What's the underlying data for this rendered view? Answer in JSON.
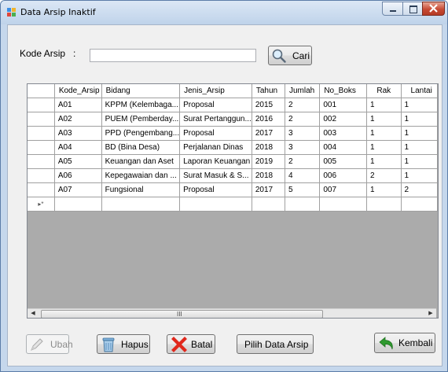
{
  "window": {
    "title": "Data Arsip Inaktif"
  },
  "search": {
    "label": "Kode Arsip   :",
    "value": "",
    "button_label": "Cari"
  },
  "grid": {
    "columns": [
      "Kode_Arsip",
      "Bidang",
      "Jenis_Arsip",
      "Tahun",
      "Jumlah",
      "No_Boks",
      "Rak",
      "Lantai"
    ],
    "rows": [
      [
        "A01",
        "KPPM (Kelembaga...",
        "Proposal",
        "2015",
        "2",
        "001",
        "1",
        "1"
      ],
      [
        "A02",
        "PUEM (Pemberday...",
        "Surat Pertanggun...",
        "2016",
        "2",
        "002",
        "1",
        "1"
      ],
      [
        "A03",
        "PPD (Pengembang...",
        "Proposal",
        "2017",
        "3",
        "003",
        "1",
        "1"
      ],
      [
        "A04",
        "BD (Bina Desa)",
        "Perjalanan Dinas",
        "2018",
        "3",
        "004",
        "1",
        "1"
      ],
      [
        "A05",
        "Keuangan dan Aset",
        "Laporan Keuangan",
        "2019",
        "2",
        "005",
        "1",
        "1"
      ],
      [
        "A06",
        "Kepegawaian dan ...",
        "Surat Masuk & S...",
        "2018",
        "4",
        "006",
        "2",
        "1"
      ],
      [
        "A07",
        "Fungsional",
        "Proposal",
        "2017",
        "5",
        "007",
        "1",
        "2"
      ]
    ],
    "new_row_marker": "▸*",
    "scroll_grip": "III"
  },
  "buttons": {
    "ubah": "Ubah",
    "hapus": "Hapus",
    "batal": "Batal",
    "pilih": "Pilih Data Arsip",
    "kembali": "Kembali"
  },
  "icons": {
    "app": "grid-app-icon",
    "search": "magnifier-icon",
    "ubah": "pencil-icon",
    "hapus": "trash-icon",
    "batal": "red-x-icon",
    "kembali": "green-back-arrow-icon"
  },
  "colors": {
    "title_bar": "#c5d7ec",
    "client_bg": "#f0f0f0",
    "grid_empty_bg": "#ababab",
    "close_button": "#c74a34",
    "batal_icon": "#e0281c",
    "kembali_icon": "#2f9a2f"
  }
}
